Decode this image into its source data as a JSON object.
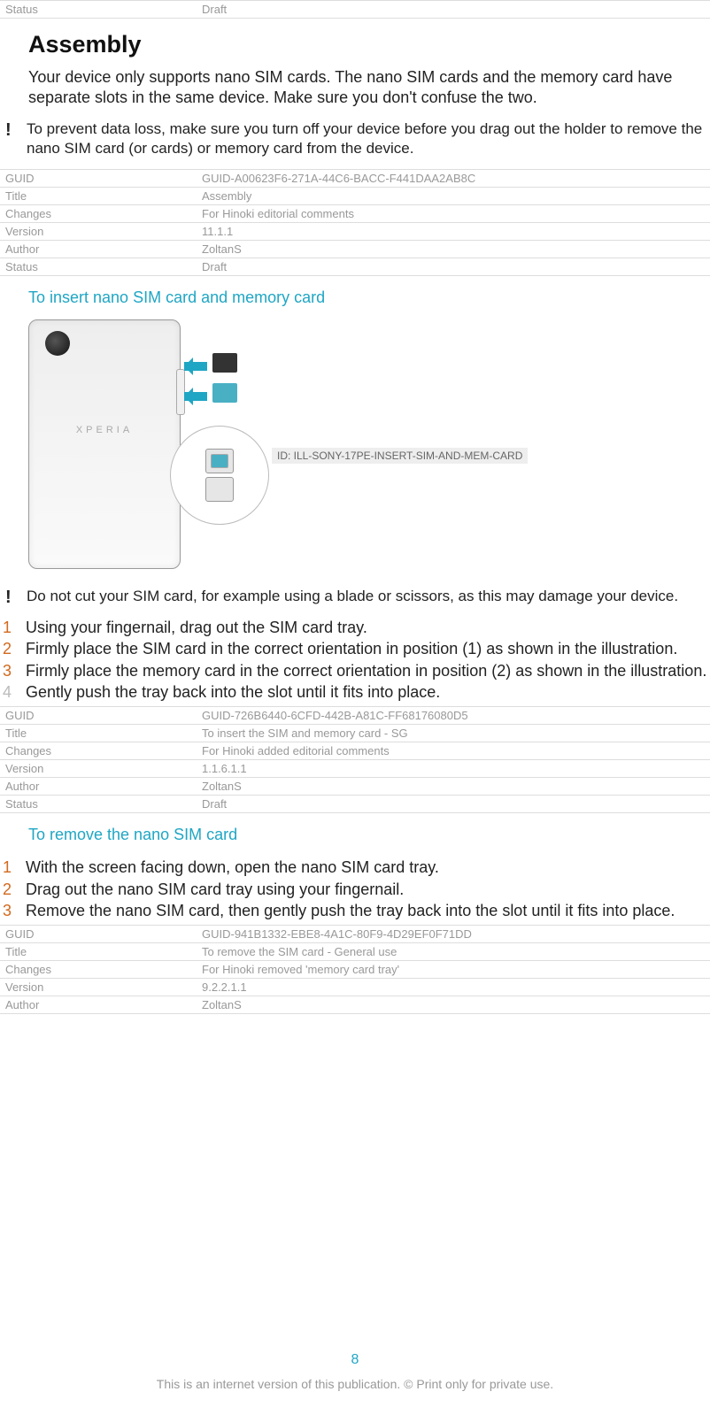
{
  "top_meta": {
    "rows": [
      {
        "key": "Status",
        "value": "Draft"
      }
    ]
  },
  "section_title": "Assembly",
  "intro_paragraph": "Your device only supports nano SIM cards. The nano SIM cards and the memory card have separate slots in the same device. Make sure you don't confuse the two.",
  "note1": "To prevent data loss, make sure you turn off your device before you drag out the holder to remove the nano SIM card (or cards) or memory card from the device.",
  "meta1": {
    "rows": [
      {
        "key": "GUID",
        "value": "GUID-A00623F6-271A-44C6-BACC-F441DAA2AB8C"
      },
      {
        "key": "Title",
        "value": "Assembly"
      },
      {
        "key": "Changes",
        "value": "For Hinoki editorial comments"
      },
      {
        "key": "Version",
        "value": "11.1.1"
      },
      {
        "key": "Author",
        "value": "ZoltanS"
      },
      {
        "key": "Status",
        "value": "Draft"
      }
    ]
  },
  "subheading1": "To insert nano SIM card and memory card",
  "phone_brand": "XPERIA",
  "ill_id": "ID: ILL-SONY-17PE-INSERT-SIM-AND-MEM-CARD",
  "note2": "Do not cut your SIM card, for example using a blade or scissors, as this may damage your device.",
  "steps1": [
    "Using your fingernail, drag out the SIM card tray.",
    "Firmly place the SIM card in the correct orientation in position (1) as shown in the illustration.",
    "Firmly place the memory card in the correct orientation in position (2) as shown in the illustration.",
    "Gently push the tray back into the slot until it fits into place."
  ],
  "meta2": {
    "rows": [
      {
        "key": "GUID",
        "value": "GUID-726B6440-6CFD-442B-A81C-FF68176080D5"
      },
      {
        "key": "Title",
        "value": "To insert the SIM and memory card - SG"
      },
      {
        "key": "Changes",
        "value": "For Hinoki added editorial comments"
      },
      {
        "key": "Version",
        "value": "1.1.6.1.1"
      },
      {
        "key": "Author",
        "value": "ZoltanS"
      },
      {
        "key": "Status",
        "value": "Draft"
      }
    ]
  },
  "subheading2": "To remove the nano SIM card",
  "steps2": [
    "With the screen facing down, open the nano SIM card tray.",
    "Drag out the nano SIM card tray using your fingernail.",
    "Remove the nano SIM card, then gently push the tray back into the slot until it fits into place."
  ],
  "meta3": {
    "rows": [
      {
        "key": "GUID",
        "value": "GUID-941B1332-EBE8-4A1C-80F9-4D29EF0F71DD"
      },
      {
        "key": "Title",
        "value": "To remove the SIM card - General use"
      },
      {
        "key": "Changes",
        "value": "For Hinoki removed 'memory card tray'"
      },
      {
        "key": "Version",
        "value": "9.2.2.1.1"
      },
      {
        "key": "Author",
        "value": "ZoltanS"
      }
    ]
  },
  "page_number": "8",
  "footer": "This is an internet version of this publication. © Print only for private use."
}
